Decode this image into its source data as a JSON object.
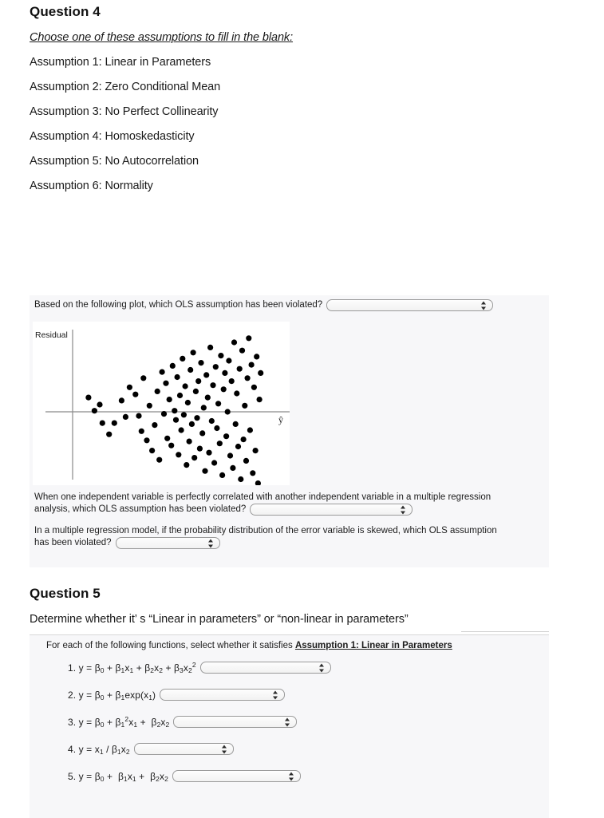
{
  "question4": {
    "heading": "Question 4",
    "subheading": "Choose one of these assumptions to fill in the blank:",
    "assumptions": [
      "Assumption 1: Linear in Parameters",
      "Assumption 2: Zero Conditional Mean",
      "Assumption 3: No Perfect Collinearity",
      "Assumption 4: Homoskedasticity",
      "Assumption 5: No Autocorrelation",
      "Assumption 6: Normality"
    ],
    "panel": {
      "item_a": {
        "prompt": "Based on the following plot, which OLS assumption has been violated?",
        "select_value": ""
      },
      "item_b": {
        "prompt_line1": "When one independent variable is perfectly correlated with another independent variable in a multiple regression",
        "prompt_line2": "analysis, which OLS assumption has been violated?",
        "select_value": ""
      },
      "item_c": {
        "prompt_line1": "In a multiple regression model, if the probability distribution of the error variable is skewed, which OLS assumption",
        "prompt_line2": "has been violated?",
        "select_value": ""
      }
    }
  },
  "residual_plot": {
    "y_axis_label": "Residual",
    "x_axis_label": "ŷ",
    "background": "#ffffff",
    "point_color": "#000000",
    "axis_color": "#8a8a8a",
    "points": [
      [
        24,
        14
      ],
      [
        33,
        1
      ],
      [
        41,
        7
      ],
      [
        45,
        -11
      ],
      [
        55,
        -22
      ],
      [
        63,
        -11
      ],
      [
        74,
        11
      ],
      [
        80,
        -5
      ],
      [
        86,
        24
      ],
      [
        95,
        17
      ],
      [
        100,
        -4
      ],
      [
        104,
        -19
      ],
      [
        107,
        33
      ],
      [
        112,
        -28
      ],
      [
        116,
        6
      ],
      [
        120,
        -38
      ],
      [
        124,
        -13
      ],
      [
        128,
        20
      ],
      [
        131,
        -47
      ],
      [
        135,
        39
      ],
      [
        138,
        -2
      ],
      [
        141,
        28
      ],
      [
        143,
        -26
      ],
      [
        146,
        12
      ],
      [
        149,
        -33
      ],
      [
        151,
        45
      ],
      [
        154,
        1
      ],
      [
        156,
        -8
      ],
      [
        158,
        34
      ],
      [
        160,
        -42
      ],
      [
        162,
        16
      ],
      [
        164,
        -18
      ],
      [
        166,
        52
      ],
      [
        168,
        -3
      ],
      [
        170,
        25
      ],
      [
        172,
        -52
      ],
      [
        174,
        9
      ],
      [
        176,
        -29
      ],
      [
        178,
        41
      ],
      [
        180,
        -12
      ],
      [
        182,
        58
      ],
      [
        184,
        -45
      ],
      [
        186,
        20
      ],
      [
        188,
        -6
      ],
      [
        190,
        30
      ],
      [
        192,
        -36
      ],
      [
        194,
        48
      ],
      [
        196,
        -21
      ],
      [
        198,
        4
      ],
      [
        200,
        -58
      ],
      [
        202,
        36
      ],
      [
        204,
        14
      ],
      [
        206,
        -40
      ],
      [
        208,
        63
      ],
      [
        210,
        -9
      ],
      [
        212,
        26
      ],
      [
        214,
        -50
      ],
      [
        216,
        44
      ],
      [
        218,
        -16
      ],
      [
        220,
        8
      ],
      [
        222,
        -31
      ],
      [
        224,
        55
      ],
      [
        226,
        -62
      ],
      [
        228,
        22
      ],
      [
        230,
        38
      ],
      [
        232,
        -24
      ],
      [
        234,
        0
      ],
      [
        236,
        50
      ],
      [
        238,
        -43
      ],
      [
        240,
        30
      ],
      [
        242,
        -55
      ],
      [
        244,
        68
      ],
      [
        246,
        -12
      ],
      [
        248,
        18
      ],
      [
        250,
        -34
      ],
      [
        252,
        42
      ],
      [
        254,
        -66
      ],
      [
        256,
        60
      ],
      [
        258,
        -27
      ],
      [
        260,
        6
      ],
      [
        262,
        -48
      ],
      [
        264,
        33
      ],
      [
        266,
        72
      ],
      [
        268,
        -18
      ],
      [
        270,
        46
      ],
      [
        272,
        -60
      ],
      [
        274,
        24
      ],
      [
        276,
        -38
      ],
      [
        278,
        54
      ],
      [
        280,
        -70
      ],
      [
        282,
        12
      ],
      [
        284,
        38
      ]
    ]
  },
  "question5": {
    "heading": "Question 5",
    "prompt": "Determine whether it’ s  “Linear in parameters”  or  “non-linear in parameters”",
    "panel_title_lead": "For each of the following functions, select whether it satisfies ",
    "panel_title_bold": "Assumption 1: Linear in Parameters",
    "equations": [
      {
        "number": "1.",
        "html": "y = β<sub>0</sub> + β<sub>1</sub>x<sub>1</sub> + β<sub>2</sub>x<sub>2</sub> + β<sub>3</sub>x<sub>2</sub><sup>2</sup>",
        "select_value": ""
      },
      {
        "number": "2.",
        "html": "y = β<sub>0</sub> + β<sub>1</sub>exp(x<sub>1</sub>)",
        "select_value": ""
      },
      {
        "number": "3.",
        "html": "y = β<sub>0</sub> + β<sub>1</sub><sup>2</sup>x<sub>1</sub> +  β<sub>2</sub>x<sub>2</sub>",
        "select_value": ""
      },
      {
        "number": "4.",
        "html": "y = x<sub>1</sub> / β<sub>1</sub>x<sub>2</sub>",
        "select_value": ""
      },
      {
        "number": "5.",
        "html": "y = β<sub>0</sub> +  β<sub>1</sub>x<sub>1</sub> +  β<sub>2</sub>x<sub>2</sub>",
        "select_value": ""
      }
    ]
  },
  "colors": {
    "panel_background": "#f7f7f9",
    "page_background": "#ffffff",
    "text": "#1a1a1a"
  }
}
